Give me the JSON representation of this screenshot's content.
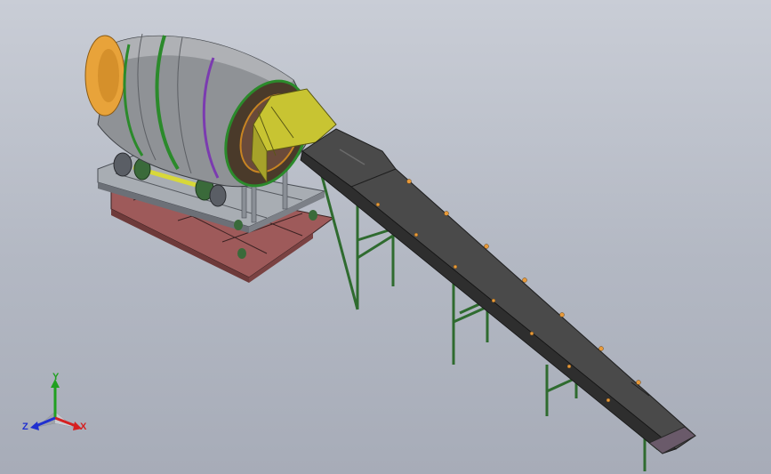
{
  "viewport": {
    "background_top": "#c9cdd6",
    "background_bottom": "#a7acb8"
  },
  "model": {
    "drum_color": "#8f9296",
    "drum_end_color": "#e8a33a",
    "ring_color": "#2b8a2b",
    "ring_accent_color": "#7b3bb0",
    "hopper_color": "#c8c432",
    "base_frame_color": "#9e5a5a",
    "structure_color": "#2f6b2f",
    "belt_color": "#4a4a4a",
    "roller_color": "#e89a3a"
  },
  "triad": {
    "x_label": "X",
    "y_label": "Y",
    "z_label": "Z",
    "x_color": "#d62020",
    "y_color": "#20a020",
    "z_color": "#2030d0"
  }
}
